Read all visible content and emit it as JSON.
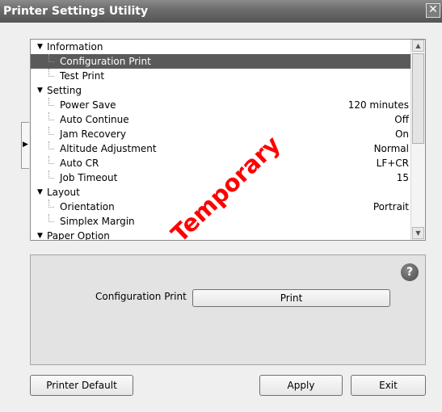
{
  "window": {
    "title": "Printer Settings Utility",
    "close_label": "✕"
  },
  "tree": {
    "rows": [
      {
        "label": "Information",
        "value": "",
        "level": 0,
        "expanded": true,
        "selected": false
      },
      {
        "label": "Configuration Print",
        "value": "",
        "level": 1,
        "selected": true
      },
      {
        "label": "Test Print",
        "value": "",
        "level": 1,
        "selected": false
      },
      {
        "label": "Setting",
        "value": "",
        "level": 0,
        "expanded": true,
        "selected": false
      },
      {
        "label": "Power Save",
        "value": "120 minutes",
        "level": 1,
        "selected": false
      },
      {
        "label": "Auto Continue",
        "value": "Off",
        "level": 1,
        "selected": false
      },
      {
        "label": "Jam Recovery",
        "value": "On",
        "level": 1,
        "selected": false
      },
      {
        "label": "Altitude Adjustment",
        "value": "Normal",
        "level": 1,
        "selected": false
      },
      {
        "label": "Auto CR",
        "value": "LF+CR",
        "level": 1,
        "selected": false
      },
      {
        "label": "Job Timeout",
        "value": "15",
        "level": 1,
        "selected": false
      },
      {
        "label": "Layout",
        "value": "",
        "level": 0,
        "expanded": true,
        "selected": false
      },
      {
        "label": "Orientation",
        "value": "Portrait",
        "level": 1,
        "selected": false
      },
      {
        "label": "Simplex Margin",
        "value": "",
        "level": 1,
        "selected": false
      },
      {
        "label": "Paper Option",
        "value": "",
        "level": 0,
        "expanded": true,
        "selected": false
      }
    ]
  },
  "detail": {
    "config_label": "Configuration Print",
    "print_button": "Print",
    "help_label": "?"
  },
  "footer": {
    "printer_default": "Printer Default",
    "apply": "Apply",
    "exit": "Exit"
  },
  "watermark": "Temporary",
  "colors": {
    "selected_row": "#5a5a5a",
    "watermark": "#ff0000"
  }
}
